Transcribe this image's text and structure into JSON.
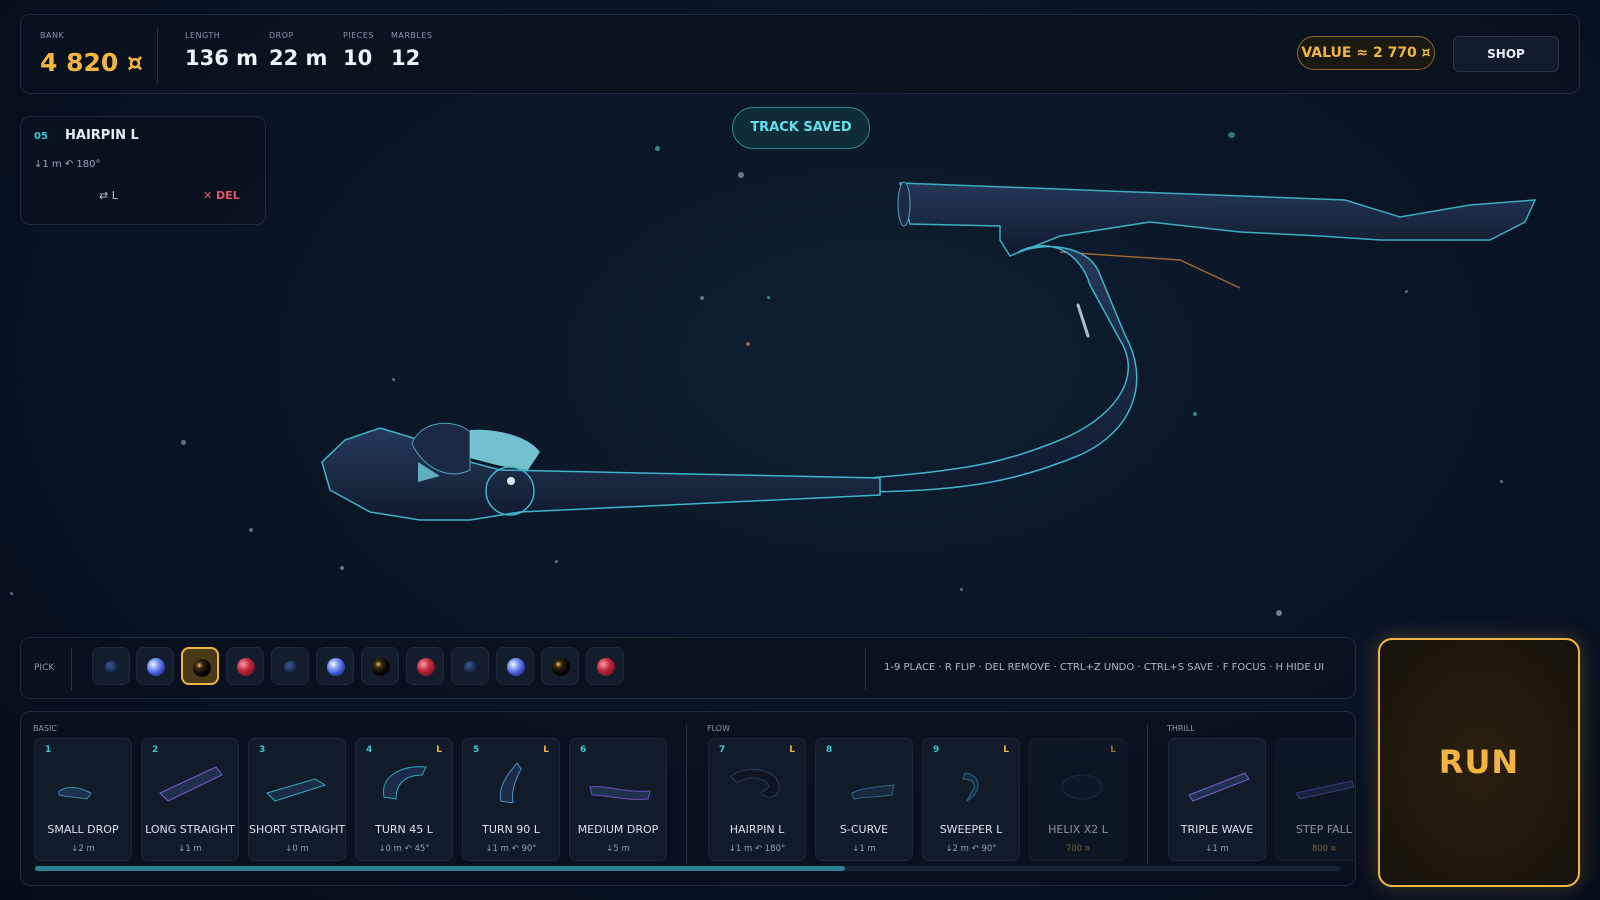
{
  "stats": {
    "bank_label": "BANK",
    "bank_value": "4 820 ¤",
    "length_label": "LENGTH",
    "length_value": "136 m",
    "drop_label": "DROP",
    "drop_value": "22 m",
    "pieces_label": "PIECES",
    "pieces_value": "10",
    "marbles_label": "MARBLES",
    "marbles_value": "12"
  },
  "value_pill": "VALUE ≈ 2 770 ¤",
  "shop_label": "SHOP",
  "toast": "TRACK SAVED",
  "selected_piece": {
    "index": "05",
    "name": "HAIRPIN L",
    "stats": "↓1 m  ↶ 180°",
    "flip_label": "⇄  L",
    "delete_label": "✕  DEL"
  },
  "pick": {
    "label": "PICK",
    "selected_index": 2,
    "marbles": [
      {
        "color": "navy"
      },
      {
        "color": "blue"
      },
      {
        "color": "black"
      },
      {
        "color": "red"
      },
      {
        "color": "navy"
      },
      {
        "color": "blue"
      },
      {
        "color": "black"
      },
      {
        "color": "red"
      },
      {
        "color": "navy"
      },
      {
        "color": "blue"
      },
      {
        "color": "black"
      },
      {
        "color": "red"
      }
    ]
  },
  "shortcuts": "1-9 PLACE  ·  R FLIP  ·  DEL REMOVE  ·  CTRL+Z UNDO  ·  CTRL+S SAVE  ·  F FOCUS  ·  H HIDE UI",
  "tray": {
    "groups": [
      "BASIC",
      "FLOW",
      "THRILL"
    ],
    "pieces": [
      {
        "key": "1",
        "name": "SMALL DROP",
        "sub": "↓2 m",
        "L": ""
      },
      {
        "key": "2",
        "name": "LONG STRAIGHT",
        "sub": "↓1 m",
        "L": ""
      },
      {
        "key": "3",
        "name": "SHORT STRAIGHT",
        "sub": "↓0 m",
        "L": ""
      },
      {
        "key": "4",
        "name": "TURN 45 L",
        "sub": "↓0 m  ↶ 45°",
        "L": "L"
      },
      {
        "key": "5",
        "name": "TURN 90 L",
        "sub": "↓1 m  ↶ 90°",
        "L": "L"
      },
      {
        "key": "6",
        "name": "MEDIUM DROP",
        "sub": "↓5 m",
        "L": ""
      },
      {
        "key": "7",
        "name": "HAIRPIN L",
        "sub": "↓1 m  ↶ 180°",
        "L": "L"
      },
      {
        "key": "8",
        "name": "S-CURVE",
        "sub": "↓1 m",
        "L": ""
      },
      {
        "key": "9",
        "name": "SWEEPER L",
        "sub": "↓2 m  ↶ 90°",
        "L": "L"
      },
      {
        "key": "",
        "name": "HELIX X2 L",
        "price": "700 ¤",
        "L": "L"
      },
      {
        "key": "",
        "name": "TRIPLE WAVE",
        "sub": "↓1 m",
        "L": ""
      },
      {
        "key": "",
        "name": "STEP FALL",
        "price": "800 ¤",
        "L": ""
      }
    ]
  },
  "run_label": "RUN",
  "colors": {
    "accent": "#f2b544",
    "cyan": "#3cc7d8",
    "danger": "#e8556b"
  }
}
